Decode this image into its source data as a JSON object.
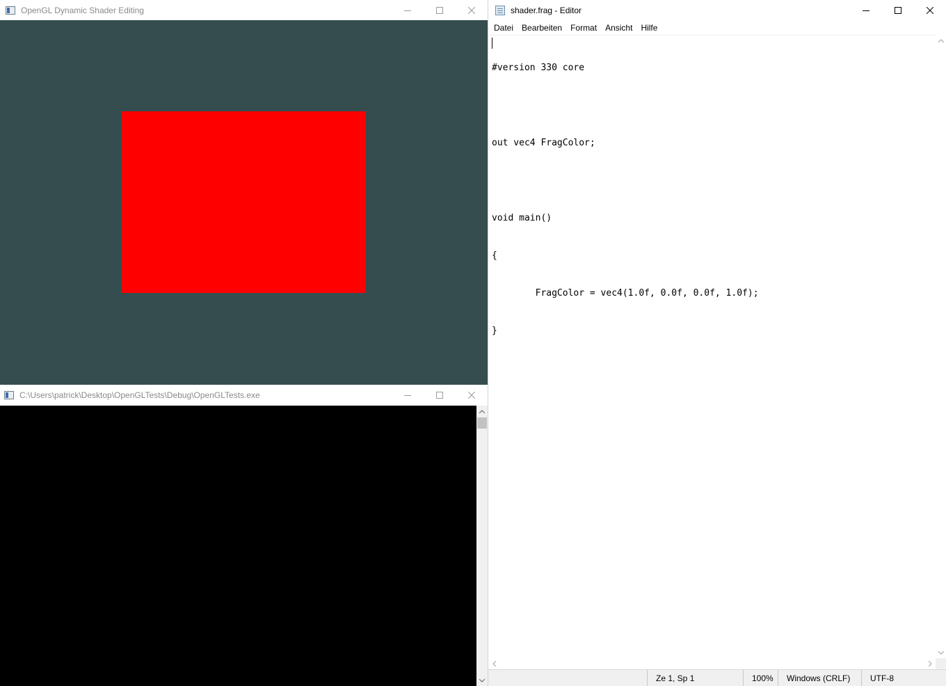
{
  "gl_window": {
    "title": "OpenGL Dynamic Shader Editing",
    "icon": "app-window-icon",
    "clear_color": "#364d4f",
    "quad_color": "#ff0000"
  },
  "console_window": {
    "title": "C:\\Users\\patrick\\Desktop\\OpenGLTests\\Debug\\OpenGLTests.exe",
    "icon": "console-icon",
    "background": "#000000"
  },
  "notepad": {
    "title": "shader.frag - Editor",
    "icon": "notepad-icon",
    "menu": [
      "Datei",
      "Bearbeiten",
      "Format",
      "Ansicht",
      "Hilfe"
    ],
    "code_lines": [
      "#version 330 core",
      "",
      "out vec4 FragColor;",
      "",
      "void main()",
      "{",
      "\tFragColor = vec4(1.0f, 0.0f, 0.0f, 1.0f);",
      "}"
    ],
    "status": {
      "position": "Ze 1, Sp 1",
      "zoom": "100%",
      "line_endings": "Windows (CRLF)",
      "encoding": "UTF-8"
    }
  },
  "caption_buttons": [
    "minimize",
    "maximize",
    "close"
  ]
}
